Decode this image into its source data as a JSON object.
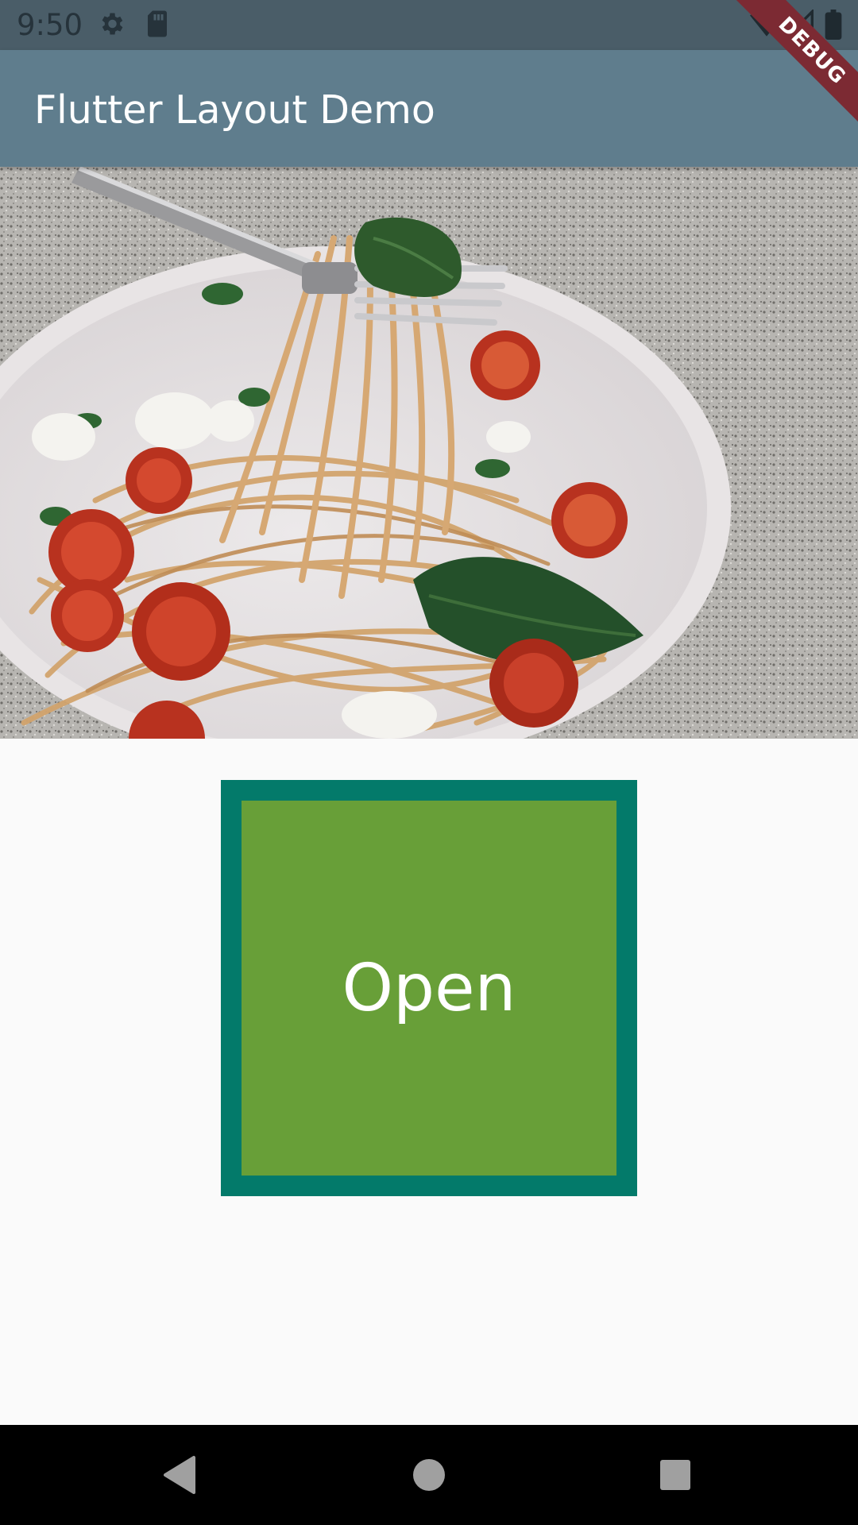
{
  "status_bar": {
    "time": "9:50",
    "icons": [
      "gear-icon",
      "sd-card-icon",
      "wifi-icon",
      "signal-icon",
      "battery-icon"
    ]
  },
  "debug_banner": {
    "label": "DEBUG"
  },
  "app_bar": {
    "title": "Flutter Layout Demo"
  },
  "hero_image": {
    "subject": "spaghetti-with-tomatoes-and-basil-on-fork"
  },
  "open_box": {
    "label": "Open"
  },
  "nav_bar": {
    "icons": [
      "back-icon",
      "home-icon",
      "recents-icon"
    ]
  },
  "colors": {
    "status_bar": "#4a5d68",
    "app_bar": "#5f7d8d",
    "box_border": "#037a6a",
    "box_fill": "#689f38",
    "background": "#fafafa",
    "debug_banner": "#7c2a33"
  }
}
